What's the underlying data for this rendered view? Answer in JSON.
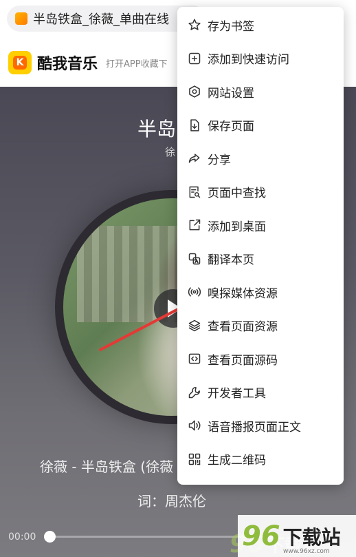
{
  "browser": {
    "url_text": "半岛铁盒_徐薇_单曲在线"
  },
  "site": {
    "brand": "酷我音乐",
    "logo_letter": "K",
    "open_app_text": "打开APP收藏下"
  },
  "player": {
    "title": "半岛",
    "artist": "徐",
    "lyric_line1": "徐薇 - 半岛铁盒 (徐薇",
    "lyric_line2": "词：周杰伦",
    "time_current": "00:00",
    "progress": 0
  },
  "menu": {
    "items": [
      {
        "label": "存为书签",
        "icon": "star-icon"
      },
      {
        "label": "添加到快速访问",
        "icon": "plus-square-icon"
      },
      {
        "label": "网站设置",
        "icon": "gear-icon"
      },
      {
        "label": "保存页面",
        "icon": "save-page-icon"
      },
      {
        "label": "分享",
        "icon": "share-icon"
      },
      {
        "label": "页面中查找",
        "icon": "find-in-page-icon"
      },
      {
        "label": "添加到桌面",
        "icon": "add-to-desktop-icon"
      },
      {
        "label": "翻译本页",
        "icon": "translate-icon"
      },
      {
        "label": "嗅探媒体资源",
        "icon": "media-sniff-icon"
      },
      {
        "label": "查看页面资源",
        "icon": "layers-icon"
      },
      {
        "label": "查看页面源码",
        "icon": "source-code-icon"
      },
      {
        "label": "开发者工具",
        "icon": "wrench-icon"
      },
      {
        "label": "语音播报页面正文",
        "icon": "speaker-icon"
      },
      {
        "label": "生成二维码",
        "icon": "qr-code-icon"
      }
    ]
  },
  "watermark": {
    "number": "96",
    "text": "下载站",
    "url": "www.96xz.com"
  },
  "colors": {
    "arrow": "#e53935",
    "watermark_green": "#8fbc3c",
    "logo_yellow": "#ffcf00"
  }
}
